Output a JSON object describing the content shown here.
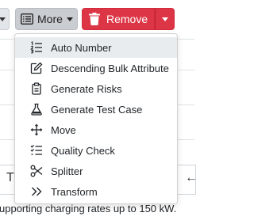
{
  "toolbar": {
    "more_label": "More",
    "remove_label": "Remove"
  },
  "background": {
    "partial_text": "upporting charging rates up to 150 kW.",
    "left_glyph": "T",
    "right_glyph": "←"
  },
  "menu": {
    "items": [
      {
        "label": "Auto Number",
        "icon": "list-ordered-icon",
        "active": true
      },
      {
        "label": "Descending Bulk Attribute",
        "icon": "edit-icon"
      },
      {
        "label": "Generate Risks",
        "icon": "clipboard-icon"
      },
      {
        "label": "Generate Test Case",
        "icon": "flask-icon"
      },
      {
        "label": "Move",
        "icon": "move-arrows-icon"
      },
      {
        "label": "Quality Check",
        "icon": "list-check-icon"
      },
      {
        "label": "Splitter",
        "icon": "scissors-icon"
      },
      {
        "label": "Transform",
        "icon": "chevrons-right-icon"
      }
    ]
  },
  "colors": {
    "remove": "#dc3545",
    "more": "#c9cdd1",
    "menu_active": "#e9ecef"
  }
}
